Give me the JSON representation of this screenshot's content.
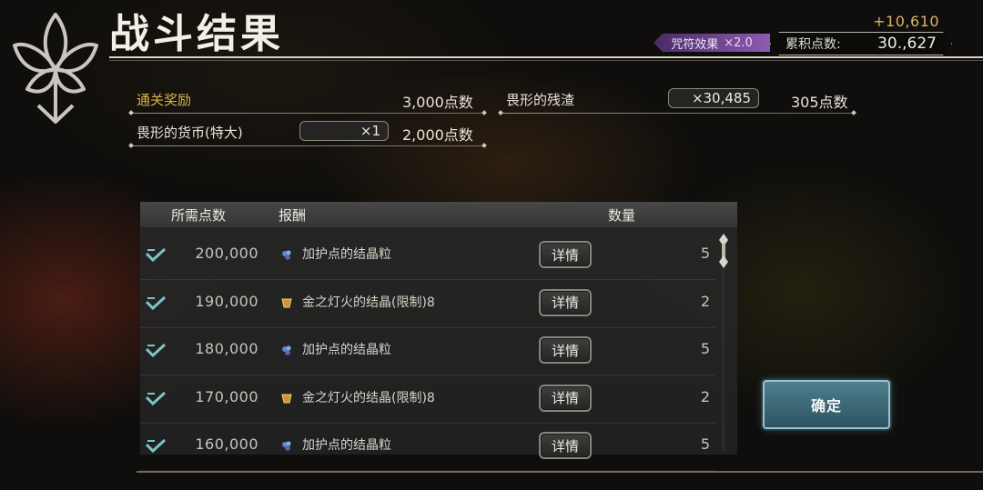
{
  "header": {
    "title": "战斗结果",
    "bonus_points": "+10,610",
    "effect": {
      "label": "咒符效果",
      "multiplier": "×2.0",
      "color": "#8c5cb0"
    },
    "accumulated": {
      "label": "累积点数:",
      "value": "30.,627"
    }
  },
  "results": {
    "clear_reward": {
      "label": "通关奖励",
      "value": "3,000点数",
      "color": "#d9b24a"
    },
    "currency": {
      "label": "畏形的货币(特大)",
      "count": "×1",
      "value": "2,000点数"
    },
    "residue": {
      "label": "畏形的残渣",
      "count": "×30,485",
      "value": "305点数"
    }
  },
  "table": {
    "headers": {
      "required": "所需点数",
      "reward": "报酬",
      "quantity": "数量"
    },
    "detail_label": "详情",
    "rows": [
      {
        "required": "200,000",
        "reward": "加护点的结晶粒",
        "icon": "blue-crystal-icon",
        "quantity": "5"
      },
      {
        "required": "190,000",
        "reward": "金之灯火的结晶(限制)8",
        "icon": "gold-crystal-icon",
        "quantity": "2"
      },
      {
        "required": "180,000",
        "reward": "加护点的结晶粒",
        "icon": "blue-crystal-icon",
        "quantity": "5"
      },
      {
        "required": "170,000",
        "reward": "金之灯火的结晶(限制)8",
        "icon": "gold-crystal-icon",
        "quantity": "2"
      },
      {
        "required": "160,000",
        "reward": "加护点的结晶粒",
        "icon": "blue-crystal-icon",
        "quantity": "5"
      }
    ]
  },
  "confirm_label": "确定"
}
